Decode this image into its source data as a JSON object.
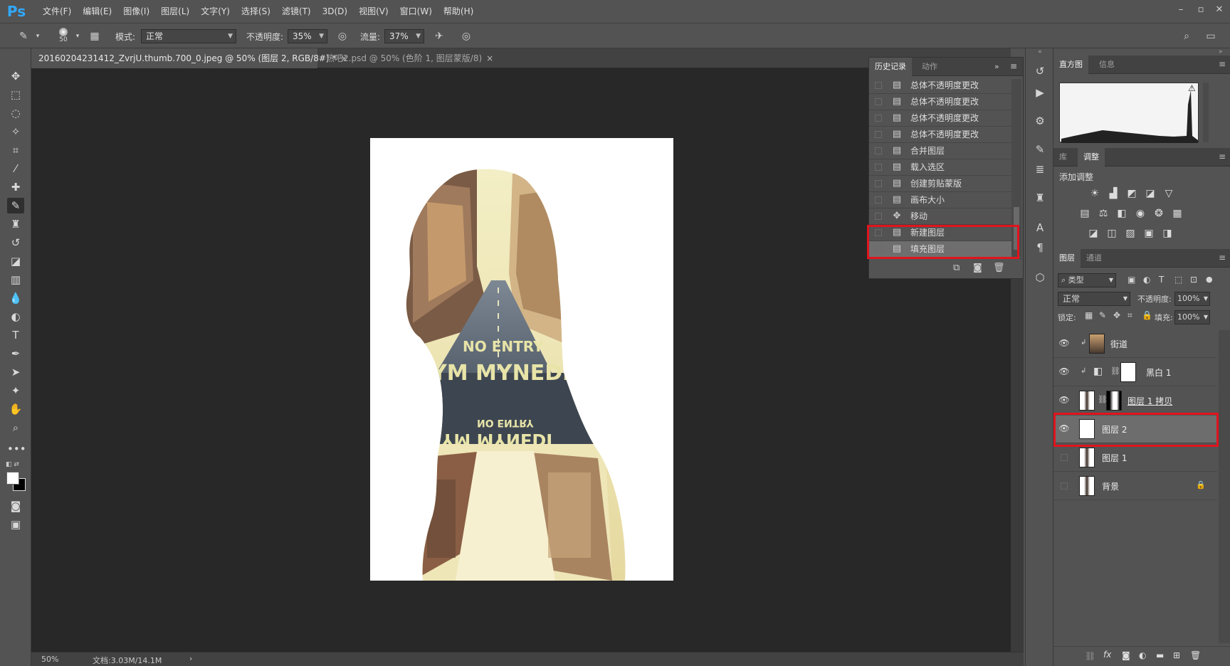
{
  "app": {
    "logo": "Ps",
    "menu": [
      "文件(F)",
      "编辑(E)",
      "图像(I)",
      "图层(L)",
      "文字(Y)",
      "选择(S)",
      "滤镜(T)",
      "3D(D)",
      "视图(V)",
      "窗口(W)",
      "帮助(H)"
    ]
  },
  "options": {
    "brush_size": "50",
    "mode_label": "模式:",
    "mode_value": "正常",
    "opacity_label": "不透明度:",
    "opacity_value": "35%",
    "flow_label": "流量:",
    "flow_value": "37%"
  },
  "documents": {
    "tabs": [
      {
        "title": "20160204231412_ZvrjU.thumb.700_0.jpeg @ 50% (图层 2, RGB/8#) *",
        "close": "×"
      },
      {
        "title": "热吧2.psd @ 50% (色阶 1, 图层蒙版/8)",
        "close": "×"
      }
    ]
  },
  "status": {
    "zoom": "50%",
    "doc_size": "文档:3.03M/14.1M",
    "arrow": "›"
  },
  "history": {
    "tabs": [
      "历史记录",
      "动作"
    ],
    "items": [
      {
        "label": "总体不透明度更改",
        "icon": "doc-icon"
      },
      {
        "label": "总体不透明度更改",
        "icon": "doc-icon"
      },
      {
        "label": "总体不透明度更改",
        "icon": "doc-icon"
      },
      {
        "label": "总体不透明度更改",
        "icon": "doc-icon"
      },
      {
        "label": "合并图层",
        "icon": "doc-icon"
      },
      {
        "label": "载入选区",
        "icon": "doc-icon"
      },
      {
        "label": "创建剪贴蒙版",
        "icon": "doc-icon"
      },
      {
        "label": "画布大小",
        "icon": "doc-icon"
      },
      {
        "label": "移动",
        "icon": "move-icon"
      },
      {
        "label": "新建图层",
        "icon": "doc-icon"
      },
      {
        "label": "填充图层",
        "icon": "doc-icon"
      }
    ],
    "selected_index": 10
  },
  "histogram_panel": {
    "tabs": [
      "直方图",
      "信息"
    ]
  },
  "adjust_panel": {
    "tabs": [
      "库",
      "调整"
    ],
    "title": "添加调整"
  },
  "layers_panel": {
    "tabs": [
      "图层",
      "通道"
    ],
    "filter_label": "类型",
    "blend_mode": "正常",
    "opacity_label": "不透明度:",
    "opacity_value": "100%",
    "lock_label": "锁定:",
    "fill_label": "填充:",
    "fill_value": "100%",
    "layers": [
      {
        "name": "街道",
        "visible": true,
        "kind": "photo-clipped"
      },
      {
        "name": "黑白 1",
        "visible": true,
        "kind": "adjustment-clipped"
      },
      {
        "name": "图层 1 拷贝",
        "visible": true,
        "kind": "masked"
      },
      {
        "name": "图层 2",
        "visible": true,
        "kind": "white-fill"
      },
      {
        "name": "图层 1",
        "visible": false,
        "kind": "portrait"
      },
      {
        "name": "背景",
        "visible": false,
        "kind": "portrait-locked"
      }
    ],
    "selected_layer": "图层 2"
  },
  "artwork_text": {
    "road_line1": "NO ENTRY",
    "road_line2": "YM MYNEDI",
    "reflection_line1": "YM MYNEDI",
    "reflection_line2": "NO ENTRY"
  },
  "colors": {
    "highlight": "#e0141e",
    "ps_blue": "#31a8ff"
  }
}
